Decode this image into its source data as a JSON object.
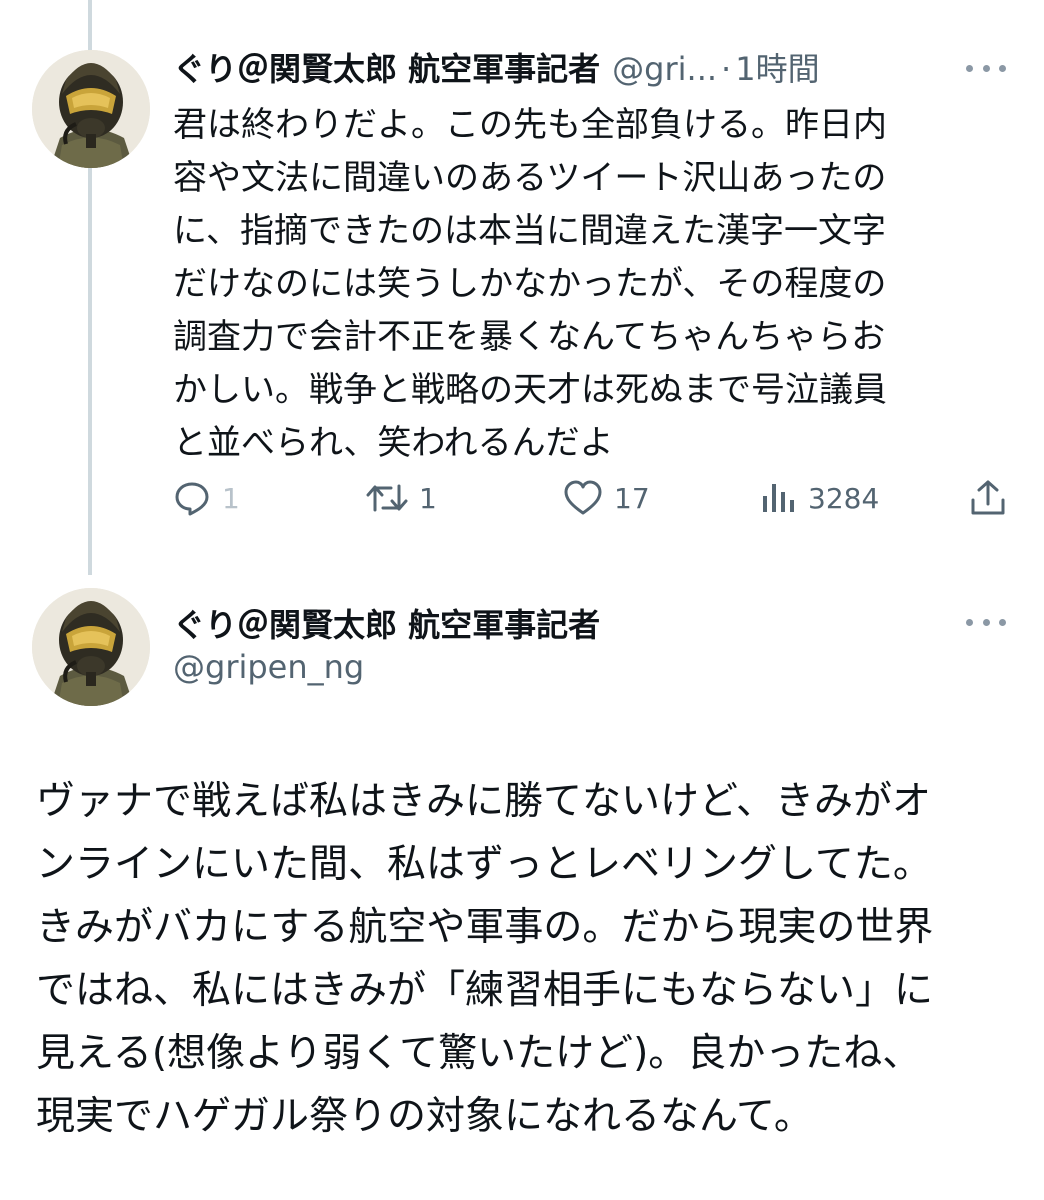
{
  "reply": {
    "display_name": "ぐり＠関賢太郎 航空軍事記者",
    "handle_truncated": "@gri...",
    "separator": "·",
    "timestamp": "1時間",
    "text": "君は終わりだよ。この先も全部負ける。昨日内\n容や文法に間違いのあるツイート沢山あったの\nに、指摘できたのは本当に間違えた漢字一文字\nだけなのには笑うしかなかったが、その程度の\n調査力で会計不正を暴くなんてちゃんちゃらお\nかしい。戦争と戦略の天才は死ぬまで号泣議員\nと並べられ、笑われるんだよ",
    "actions": {
      "replies": "1",
      "retweets": "1",
      "likes": "17",
      "views": "3284"
    },
    "icons": {
      "reply": "speech-bubble-icon",
      "retweet": "retweet-arrows-icon",
      "like": "heart-icon",
      "views": "bar-chart-icon",
      "share": "share-upload-icon"
    }
  },
  "main_tweet": {
    "display_name": "ぐり＠関賢太郎 航空軍事記者",
    "handle": "@gripen_ng",
    "text": "ヴァナで戦えば私はきみに勝てないけど、きみがオ\nンラインにいた間、私はずっとレベリングしてた。\nきみがバカにする航空や軍事の。だから現実の世界\nではね、私にはきみが「練習相手にもならない」に\n見える(想像より弱くて驚いたけど)。良かったね、\n現実でハゲガル祭りの対象になれるなんて。"
  },
  "colors": {
    "text_primary": "#0f1419",
    "text_secondary": "#536471",
    "thread_line": "#cfd9de"
  }
}
